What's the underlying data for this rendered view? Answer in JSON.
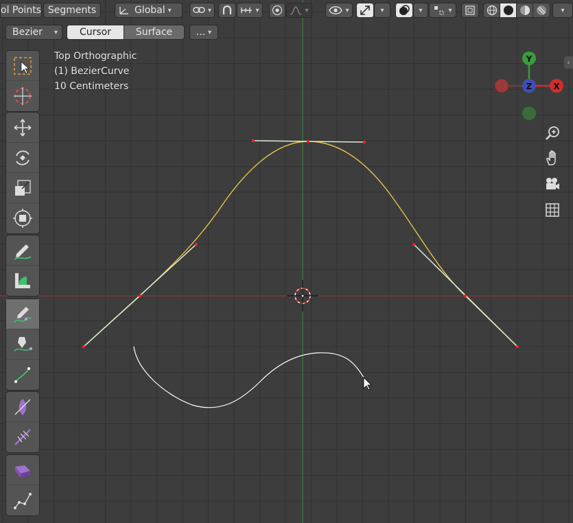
{
  "header_row1": {
    "mode_tab_left": "ol Points",
    "mode_tab_right": "Segments",
    "transform_orientation": "Global"
  },
  "header_row2": {
    "curve_type": "Bezier",
    "tab_cursor": "Cursor",
    "tab_surface": "Surface",
    "more_label": "..."
  },
  "overlay": {
    "view_name": "Top Orthographic",
    "object_name": "(1) BezierCurve",
    "scale": "10 Centimeters"
  },
  "gizmo": {
    "y_label": "Y",
    "z_label": "Z",
    "x_label": "X",
    "y_color": "#3a9c3a",
    "z_color": "#3f4fb8",
    "x_color": "#d12d2d"
  },
  "colors": {
    "curve": "#e8c24a",
    "handle_line": "#d8f0d8",
    "control_point": "#ff2020",
    "axis_x": "#8f3b3b",
    "axis_y": "#3f7a3f",
    "stroke": "#ffffff"
  },
  "icons": {
    "select": "select-box-icon",
    "cursor": "cursor-icon",
    "move": "move-icon",
    "rotate": "rotate-icon",
    "scale": "scale-icon",
    "transform": "transform-icon",
    "annotate": "annotate-icon",
    "measure": "measure-icon",
    "draw": "curve-draw-icon",
    "pen": "curve-pen-icon",
    "tilt": "tilt-icon",
    "radius": "radius-icon",
    "randomize": "randomize-icon",
    "extrude": "extrude-icon",
    "vertex_random": "vertex-randomize-icon"
  }
}
